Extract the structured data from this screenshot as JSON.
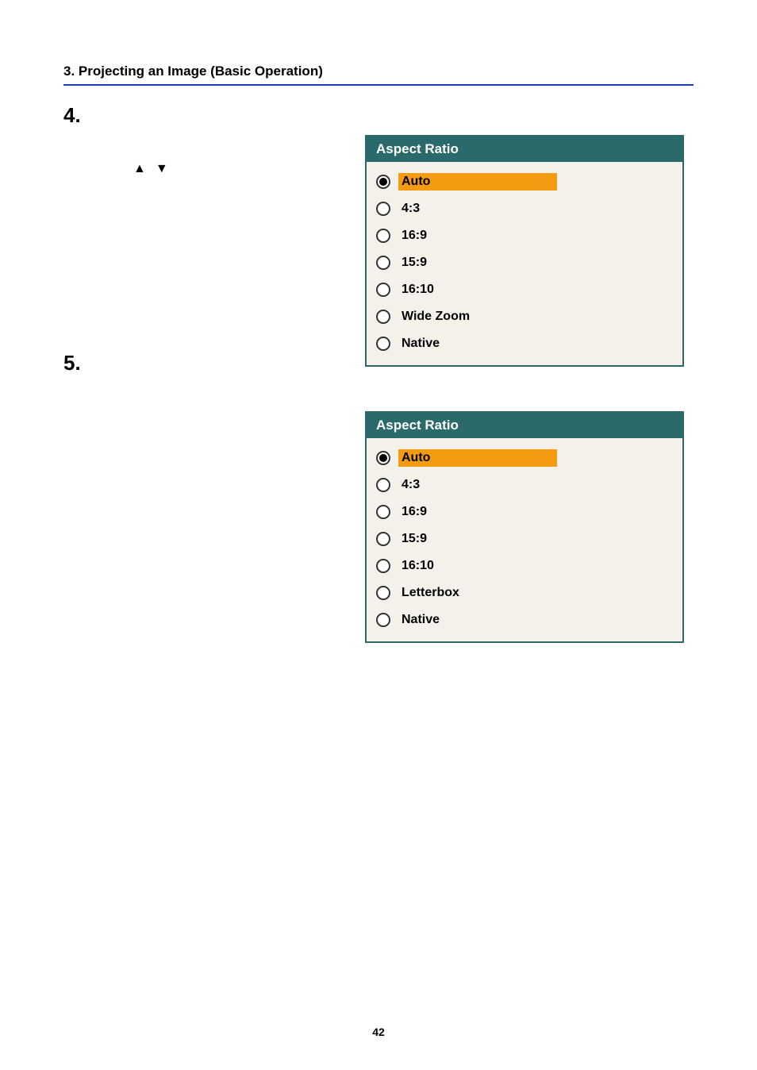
{
  "header": {
    "section_title": "3. Projecting an Image (Basic Operation)"
  },
  "steps": {
    "step4_num": "4.",
    "step5_num": "5."
  },
  "arrows": {
    "up": "▲",
    "down": "▼"
  },
  "panel1": {
    "title": "Aspect Ratio",
    "options": [
      {
        "label": "Auto",
        "selected": true
      },
      {
        "label": "4:3",
        "selected": false
      },
      {
        "label": "16:9",
        "selected": false
      },
      {
        "label": "15:9",
        "selected": false
      },
      {
        "label": "16:10",
        "selected": false
      },
      {
        "label": "Wide Zoom",
        "selected": false
      },
      {
        "label": "Native",
        "selected": false
      }
    ]
  },
  "panel2": {
    "title": "Aspect Ratio",
    "options": [
      {
        "label": "Auto",
        "selected": true
      },
      {
        "label": "4:3",
        "selected": false
      },
      {
        "label": "16:9",
        "selected": false
      },
      {
        "label": "15:9",
        "selected": false
      },
      {
        "label": "16:10",
        "selected": false
      },
      {
        "label": "Letterbox",
        "selected": false
      },
      {
        "label": "Native",
        "selected": false
      }
    ]
  },
  "footer": {
    "page_number": "42"
  }
}
